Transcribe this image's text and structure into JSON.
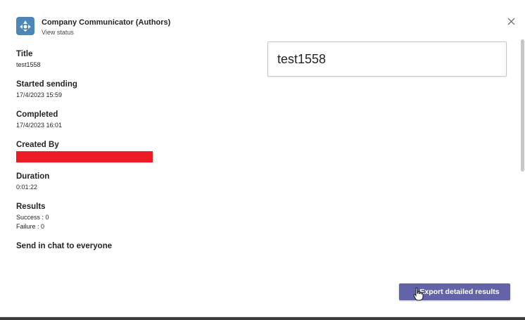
{
  "header": {
    "app_name": "Company Communicator (Authors)",
    "sub_link": "View status"
  },
  "fields": {
    "title_label": "Title",
    "title_value": "test1558",
    "started_label": "Started sending",
    "started_value": "17/4/2023 15:59",
    "completed_label": "Completed",
    "completed_value": "17/4/2023 16:01",
    "created_label": "Created By",
    "duration_label": "Duration",
    "duration_value": "0:01:22",
    "results_label": "Results",
    "success_value": "Success : 0",
    "failure_value": "Failure : 0",
    "send_label": "Send in chat to everyone"
  },
  "preview": {
    "title": "test1558"
  },
  "actions": {
    "export_label": "Export detailed results"
  },
  "colors": {
    "brand": "#6264a7",
    "redaction": "#ed1c24"
  },
  "icons": {
    "app_logo": "app-logo-icon",
    "close": "close-icon",
    "cursor": "hand-pointer-icon"
  }
}
